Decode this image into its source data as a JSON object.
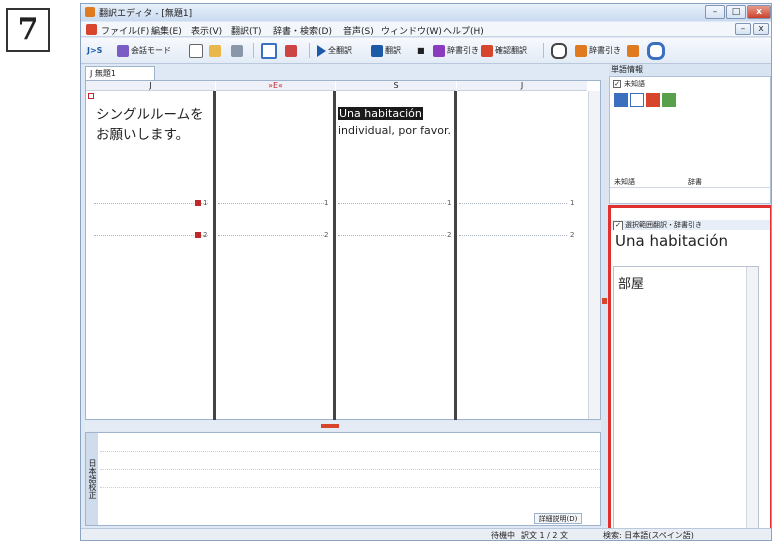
{
  "step_number": "7",
  "window": {
    "title": "翻訳エディタ - [無題1]",
    "buttons": {
      "minimize": "–",
      "maximize": "□",
      "close": "x",
      "mdi_min": "–",
      "mdi_close": "x"
    }
  },
  "menu": [
    "ファイル(F)",
    "編集(E)",
    "表示(V)",
    "翻訳(T)",
    "辞書・検索(D)",
    "音声(S)",
    "ウィンドウ(W)",
    "ヘルプ(H)"
  ],
  "toolbar": {
    "lang_pair": "J>S",
    "conversation_mode": "会話モード",
    "translate_all": "全翻訳",
    "translate": "翻訳",
    "stop": "■",
    "dictionary_lookup_button": "辞書引き",
    "check_translation": "確認翻訳"
  },
  "document_tab": "無題1",
  "editor": {
    "columns": [
      "J",
      "»E«",
      "S",
      "J"
    ],
    "source_text": "シングルルームをお願いします。",
    "translation_highlight": "Una habitación",
    "translation_rest": "individual, por favor.",
    "rows": [
      {
        "num": "1"
      },
      {
        "num": "2"
      }
    ]
  },
  "bottom_panel": {
    "label": "日本語校正",
    "button": "詳細説明(D)"
  },
  "right_panel": {
    "header": "単語情報",
    "unknown_word_checkbox": "未知語",
    "unknown_word_columns": [
      "未知語",
      "辞書"
    ],
    "lookup_checkbox": "選択範囲翻訳・辞書引き",
    "lookup_word": "Una habitación",
    "result_text": "部屋"
  },
  "statusbar": {
    "state": "待機中",
    "sentence": "訳文 1 / 2 文",
    "extra": "検索: 日本語(スペイン語)"
  },
  "colors": {
    "highlight_border": "#e03030",
    "accent": "#d6452c"
  }
}
